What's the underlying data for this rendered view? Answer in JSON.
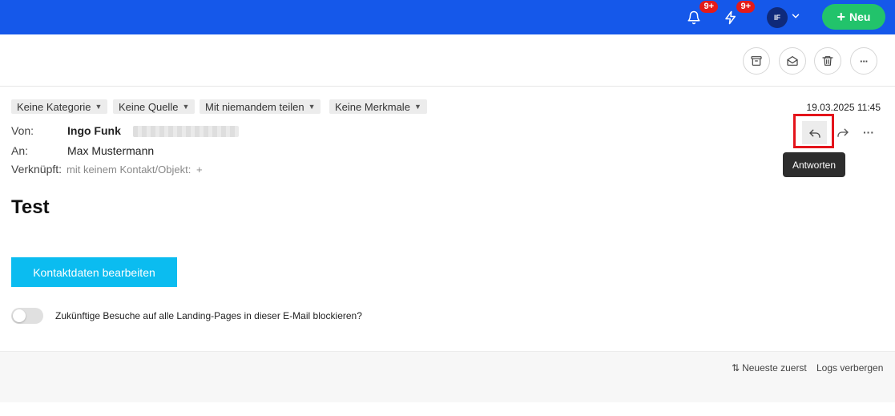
{
  "topbar": {
    "notifications": {
      "icon": "bell-icon",
      "badge": "9+"
    },
    "activity": {
      "icon": "lightning-icon",
      "badge": "9+"
    },
    "avatar": {
      "initials": "IF"
    },
    "new_button": {
      "label": "Neu"
    },
    "colors": {
      "bar": "#1558ea",
      "new_button": "#22c36b",
      "badge": "#e41a1a"
    }
  },
  "toolbar": {
    "buttons": [
      "archive-icon",
      "mark-read-icon",
      "trash-icon",
      "more-icon"
    ]
  },
  "tags": [
    {
      "label": "Keine Kategorie"
    },
    {
      "label": "Keine Quelle"
    },
    {
      "label": "Mit niemandem teilen"
    },
    {
      "label": "Keine Merkmale"
    }
  ],
  "email": {
    "date": "19.03.2025 11:45",
    "from_label": "Von:",
    "from_name": "Ingo Funk",
    "to_label": "An:",
    "to_name": "Max Mustermann",
    "linked_label": "Verknüpft:",
    "linked_value": "mit keinem Kontakt/Objekt:",
    "linked_add": "+",
    "subject": "Test",
    "cta_label": "Kontaktdaten bearbeiten",
    "block_label": "Zukünftige Besuche auf alle Landing-Pages in dieser E-Mail blockieren?"
  },
  "actions": {
    "reply_tooltip": "Antworten",
    "more": "···"
  },
  "footer": {
    "sort_label": "Neueste zuerst",
    "logs_label": "Logs verbergen"
  }
}
